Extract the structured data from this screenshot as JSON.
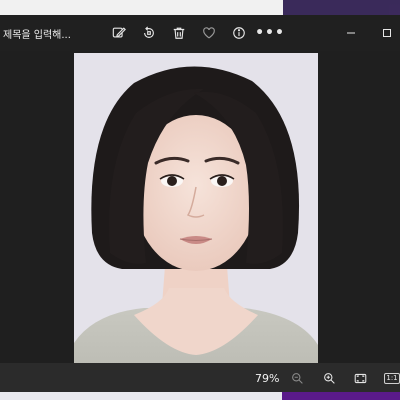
{
  "window": {
    "title": "제목을 입력해..."
  },
  "toolbar": {
    "tools": [
      {
        "name": "edit-image-icon"
      },
      {
        "name": "rotate-icon"
      },
      {
        "name": "delete-icon"
      },
      {
        "name": "favorite-icon"
      },
      {
        "name": "info-icon"
      },
      {
        "name": "more-icon",
        "glyph": "•••"
      }
    ],
    "minimize_glyph": "—",
    "maximize_glyph": "☐"
  },
  "statusbar": {
    "zoom_level": "79%",
    "actual_size_label": "1:1"
  },
  "image": {
    "subject": "portrait",
    "background_color": "#e4e2ea"
  },
  "colors": {
    "window_bg": "#202020",
    "statusbar_bg": "#2b2b2b",
    "icon_color": "#e6e6e6"
  }
}
